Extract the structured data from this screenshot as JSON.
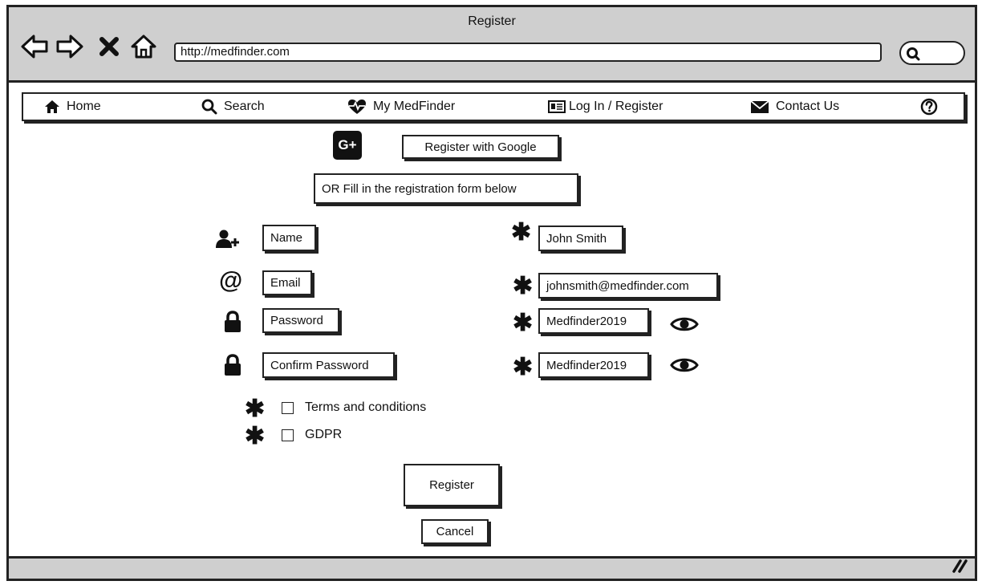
{
  "window": {
    "title": "Register"
  },
  "browser": {
    "url": "http://medfinder.com"
  },
  "menu": {
    "home": "Home",
    "search": "Search",
    "my_medfinder": "My MedFinder",
    "login_register": "Log In / Register",
    "contact": "Contact Us"
  },
  "google": {
    "button_label": "Register with Google",
    "icon_text": "G+"
  },
  "form_hint": "OR Fill in the registration form below",
  "fields": {
    "name": {
      "label": "Name",
      "value": "John Smith"
    },
    "email": {
      "label": "Email",
      "value": "johnsmith@medfinder.com"
    },
    "password": {
      "label": "Password",
      "value": "Medfinder2019"
    },
    "confirm_password": {
      "label": "Confirm Password",
      "value": "Medfinder2019"
    }
  },
  "checkboxes": {
    "terms": "Terms and conditions",
    "gdpr": "GDPR"
  },
  "actions": {
    "register": "Register",
    "cancel": "Cancel"
  },
  "required_marker": "✱",
  "icons": [
    "back-icon",
    "forward-icon",
    "stop-icon",
    "home-icon",
    "search-icon",
    "home-icon",
    "search-icon",
    "heart-pulse-icon",
    "id-card-icon",
    "envelope-icon",
    "help-icon",
    "google-plus-icon",
    "add-user-icon",
    "at-icon",
    "lock-icon",
    "eye-icon",
    "resize-grip-icon"
  ]
}
